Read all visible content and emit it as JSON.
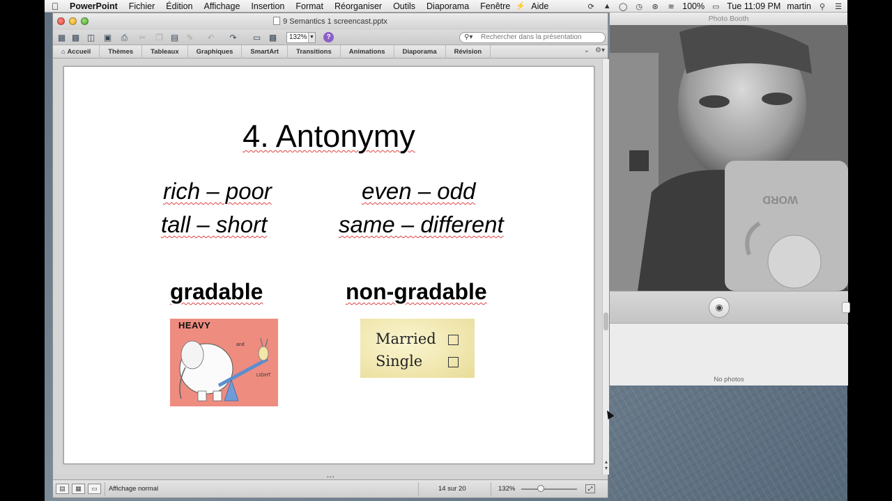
{
  "menubar": {
    "app_name": "PowerPoint",
    "items": [
      "Fichier",
      "Édition",
      "Affichage",
      "Insertion",
      "Format",
      "Réorganiser",
      "Outils",
      "Diaporama",
      "Fenêtre",
      "Aide"
    ],
    "battery": "100%",
    "clock": "Tue 11:09 PM",
    "user": "martin"
  },
  "ppt": {
    "title": "9 Semantics 1 screencast.pptx",
    "zoom": "132%",
    "search_placeholder": "Rechercher dans la présentation",
    "ribbon_tabs": [
      "Accueil",
      "Thèmes",
      "Tableaux",
      "Graphiques",
      "SmartArt",
      "Transitions",
      "Animations",
      "Diaporama",
      "Révision"
    ],
    "slide": {
      "title": "4. Antonymy",
      "pairs": [
        "rich – poor",
        "tall – short",
        "even – odd",
        "same – different"
      ],
      "gradable_label": "gradable",
      "nongradable_label": "non-gradable",
      "heavy_image": {
        "heavy": "HEAVY",
        "and": "and",
        "light": "LIGHT"
      },
      "married_image": {
        "married": "Married",
        "single": "Single"
      }
    },
    "status": {
      "view_label": "Affichage normal",
      "slide_position": "14 sur 20",
      "zoom": "132%"
    }
  },
  "photobooth": {
    "title": "Photo Booth",
    "no_photos": "No photos"
  }
}
